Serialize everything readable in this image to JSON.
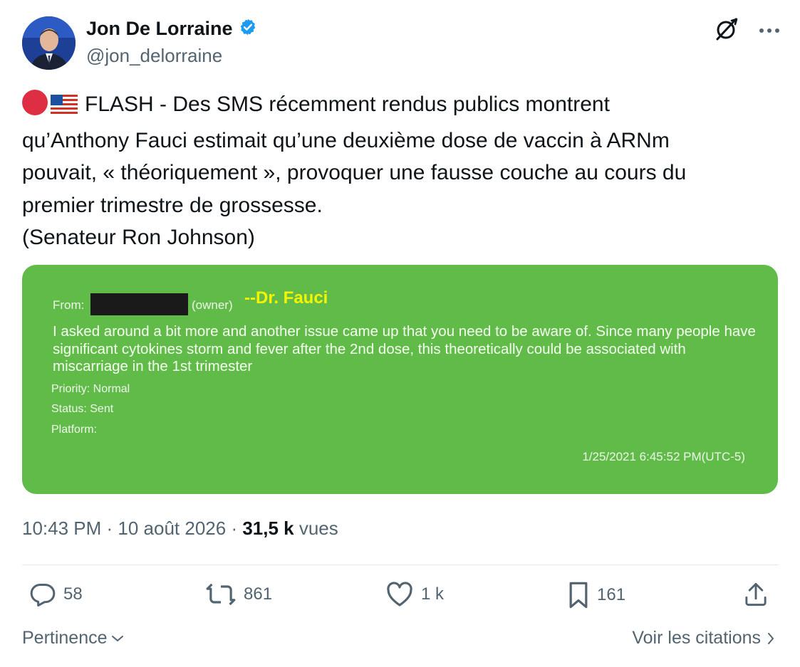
{
  "header": {
    "display_name": "Jon De Lorraine",
    "handle": "@jon_delorraine",
    "verified_icon": "verified-badge-icon",
    "grok_icon": "grok-icon",
    "more_icon": "more-icon"
  },
  "tweet": {
    "text": "FLASH - Des SMS récemment rendus publics montrent\nqu’Anthony Fauci estimait qu’une deuxième dose de vaccin à ARNm\npouvait, « théoriquement », provoquer une fausse couche au cours du\npremier trimestre de grossesse.\n(Senateur Ron Johnson)",
    "emojis": [
      "red-circle",
      "us-flag"
    ]
  },
  "media": {
    "from_label": "From:",
    "owner_label": "(owner)",
    "sender": "--Dr. Fauci",
    "body": "I asked around a bit more and another issue came up that you need to be aware of.  Since many people have significant cytokines storm and fever after the 2nd dose, this theoretically could be associated with miscarriage in the 1st trimester",
    "priority": "Priority: Normal",
    "status": "Status: Sent",
    "platform": "Platform:",
    "timestamp": "1/25/2021 6:45:52 PM(UTC-5)",
    "background_color": "#61bb49"
  },
  "meta": {
    "time": "10:43 PM",
    "sep1": " · ",
    "date": "10 août 2026",
    "sep2": " · ",
    "views_count": "31,5 k",
    "views_label": " vues"
  },
  "actions": {
    "replies": "58",
    "reposts": "861",
    "likes": "1 k",
    "bookmarks": "161"
  },
  "footer": {
    "sort_label": "Pertinence",
    "quotes_label": "Voir les citations"
  },
  "colors": {
    "text": "#0f1419",
    "secondary": "#536471",
    "verified": "#1d9bf0"
  }
}
